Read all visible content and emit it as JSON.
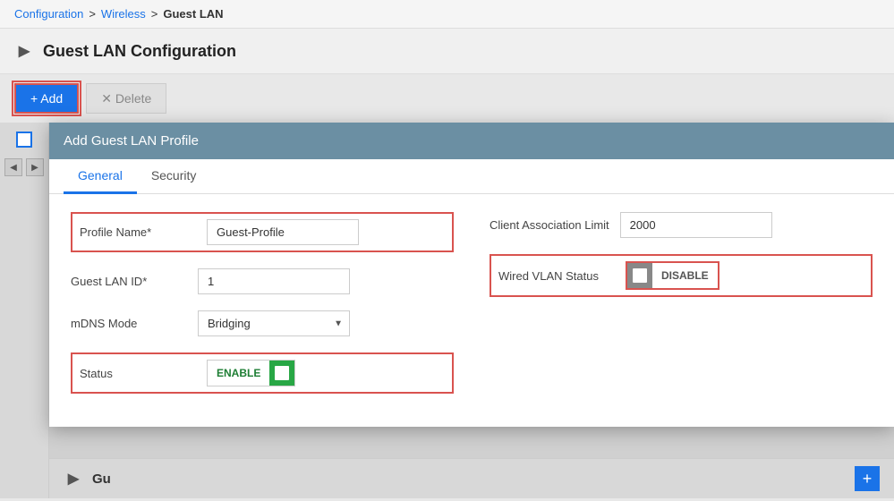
{
  "breadcrumb": {
    "configuration": "Configuration",
    "wireless": "Wireless",
    "current": "Guest LAN",
    "sep": ">"
  },
  "page_title": "Guest LAN Configuration",
  "toolbar": {
    "add_label": "+ Add",
    "delete_label": "✕  Delete"
  },
  "dialog": {
    "title": "Add Guest LAN Profile",
    "tabs": [
      {
        "label": "General",
        "active": true
      },
      {
        "label": "Security",
        "active": false
      }
    ],
    "fields": {
      "profile_name_label": "Profile Name*",
      "profile_name_value": "Guest-Profile",
      "guest_lan_id_label": "Guest LAN ID*",
      "guest_lan_id_value": "1",
      "mdns_mode_label": "mDNS Mode",
      "mdns_mode_value": "Bridging",
      "status_label": "Status",
      "status_toggle_text": "ENABLE",
      "client_assoc_label": "Client Association Limit",
      "client_assoc_value": "2000",
      "wired_vlan_label": "Wired VLAN Status",
      "wired_vlan_toggle_text": "DISABLE"
    }
  },
  "bottom": {
    "section_label": "Gu"
  },
  "icons": {
    "chevron_right": "▶",
    "chevron_left": "◀",
    "plus": "+",
    "dropdown_arrow": "▼"
  }
}
